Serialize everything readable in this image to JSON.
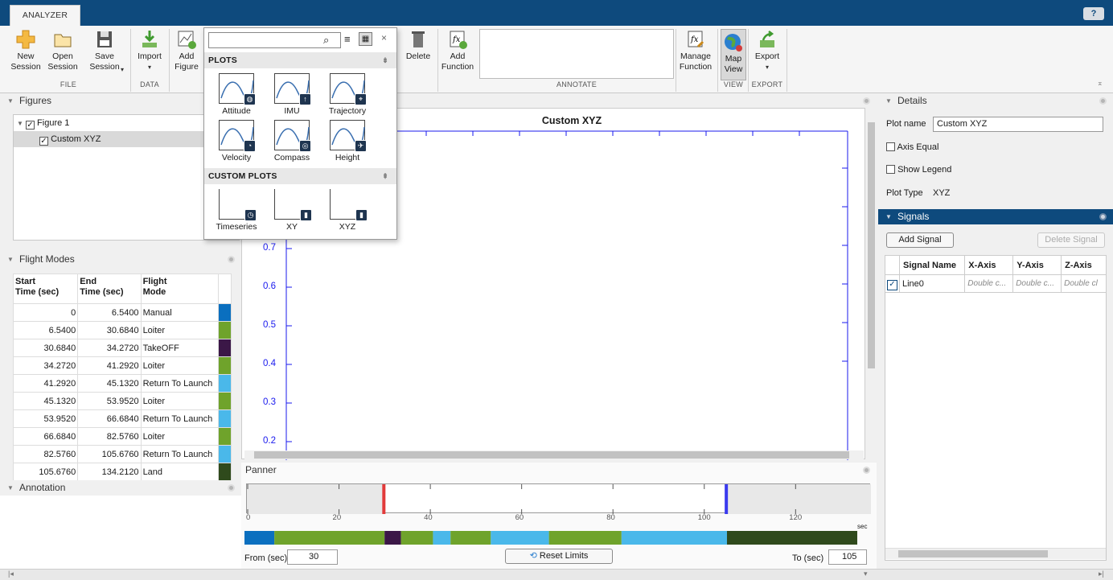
{
  "app": {
    "tab": "ANALYZER",
    "help": "?"
  },
  "toolstrip": {
    "new_session": "New\nSession",
    "open_session": "Open\nSession",
    "save_session": "Save\nSession",
    "import": "Import",
    "add_figure": "Add\nFigure",
    "delete": "Delete",
    "add_function": "Add\nFunction",
    "manage_function": "Manage\nFunction",
    "map_view": "Map\nView",
    "export": "Export",
    "groups": {
      "file": "FILE",
      "data": "DATA",
      "annotate": "ANNOTATE",
      "view": "VIEW",
      "export": "EXPORT"
    }
  },
  "plots_popup": {
    "search_placeholder": "",
    "plots_header": "PLOTS",
    "plots": [
      "Attitude",
      "IMU",
      "Trajectory",
      "Velocity",
      "Compass",
      "Height"
    ],
    "custom_header": "CUSTOM PLOTS",
    "custom_plots": [
      "Timeseries",
      "XY",
      "XYZ"
    ]
  },
  "figures": {
    "title": "Figures",
    "tree": {
      "figure": "Figure 1",
      "plot": "Custom XYZ"
    }
  },
  "flight_modes": {
    "title": "Flight Modes",
    "headers": [
      "Start\nTime (sec)",
      "End\nTime (sec)",
      "Flight\nMode"
    ],
    "rows": [
      {
        "start": "0",
        "end": "6.5400",
        "mode": "Manual",
        "color": "#0a6fbf"
      },
      {
        "start": "6.5400",
        "end": "30.6840",
        "mode": "Loiter",
        "color": "#6fa32b"
      },
      {
        "start": "30.6840",
        "end": "34.2720",
        "mode": "TakeOFF",
        "color": "#3b1747"
      },
      {
        "start": "34.2720",
        "end": "41.2920",
        "mode": "Loiter",
        "color": "#6fa32b"
      },
      {
        "start": "41.2920",
        "end": "45.1320",
        "mode": "Return To Launch",
        "color": "#4ab8ea"
      },
      {
        "start": "45.1320",
        "end": "53.9520",
        "mode": "Loiter",
        "color": "#6fa32b"
      },
      {
        "start": "53.9520",
        "end": "66.6840",
        "mode": "Return To Launch",
        "color": "#4ab8ea"
      },
      {
        "start": "66.6840",
        "end": "82.5760",
        "mode": "Loiter",
        "color": "#6fa32b"
      },
      {
        "start": "82.5760",
        "end": "105.6760",
        "mode": "Return To Launch",
        "color": "#4ab8ea"
      },
      {
        "start": "105.6760",
        "end": "134.2120",
        "mode": "Land",
        "color": "#2f4a1c"
      }
    ]
  },
  "annotation": {
    "title": "Annotation"
  },
  "plot": {
    "title": "Custom XYZ",
    "yticks": [
      "0.7",
      "0.6",
      "0.5",
      "0.4",
      "0.3",
      "0.2"
    ]
  },
  "panner": {
    "title": "Panner",
    "ticks": [
      "0",
      "20",
      "40",
      "60",
      "80",
      "100",
      "120"
    ],
    "unit": "sec",
    "from_label": "From (sec)",
    "from_value": "30",
    "to_label": "To (sec)",
    "to_value": "105",
    "reset": "Reset Limits",
    "range": {
      "max": 134.212,
      "from": 30,
      "to": 105
    }
  },
  "details": {
    "title": "Details",
    "plot_name_label": "Plot name",
    "plot_name_value": "Custom XYZ",
    "axis_equal": "Axis Equal",
    "show_legend": "Show Legend",
    "plot_type_label": "Plot Type",
    "plot_type_value": "XYZ"
  },
  "signals": {
    "title": "Signals",
    "add": "Add Signal",
    "delete": "Delete Signal",
    "headers": [
      "Signal Name",
      "X-Axis",
      "Y-Axis",
      "Z-Axis"
    ],
    "rows": [
      {
        "name": "Line0",
        "x": "Double c...",
        "y": "Double c...",
        "z": "Double cl"
      }
    ]
  },
  "colors": {
    "titlebar": "#0e4a7d",
    "accent": "#0e4a7d",
    "axis": "#1a1aee"
  }
}
